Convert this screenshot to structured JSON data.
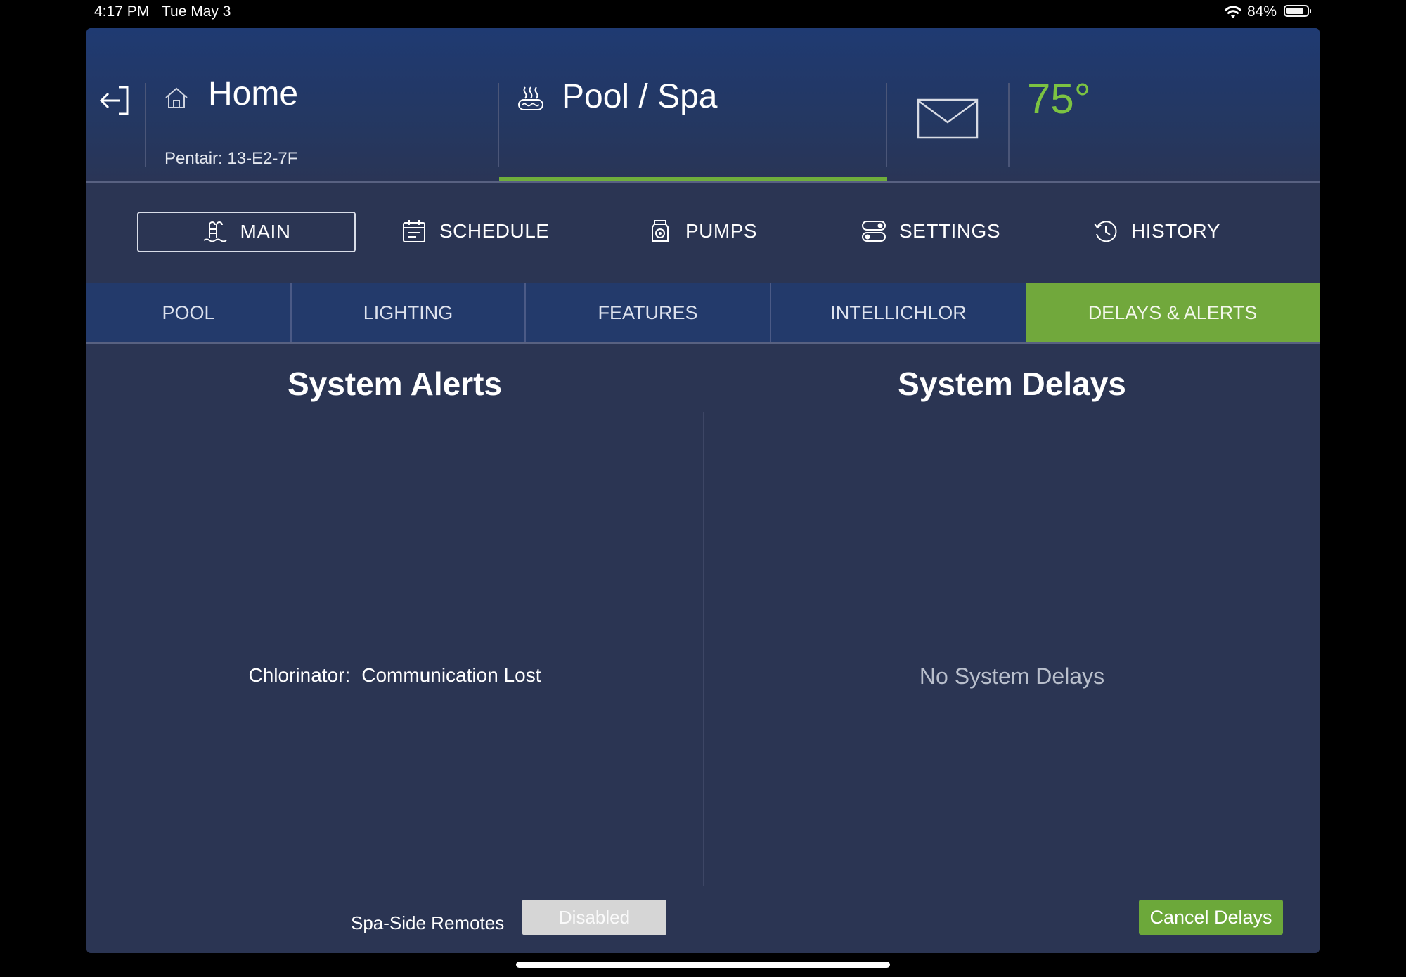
{
  "status_bar": {
    "time": "4:17 PM",
    "date": "Tue May 3",
    "battery_pct": "84%"
  },
  "header": {
    "home_title": "Home",
    "home_subtitle": "Pentair: 13-E2-7F",
    "location_title": "Pool / Spa",
    "temperature": "75°"
  },
  "topnav": {
    "main": "MAIN",
    "schedule": "SCHEDULE",
    "pumps": "PUMPS",
    "settings": "SETTINGS",
    "history": "HISTORY"
  },
  "subtabs": {
    "pool": "POOL",
    "lighting": "LIGHTING",
    "features": "FEATURES",
    "intellichlor": "INTELLICHLOR",
    "delays_alerts": "DELAYS & ALERTS"
  },
  "alerts": {
    "title": "System Alerts",
    "items": [
      {
        "label": "Chlorinator:",
        "message": "Communication Lost"
      }
    ]
  },
  "delays": {
    "title": "System Delays",
    "empty_text": "No System Delays"
  },
  "footer": {
    "spa_remotes_label": "Spa-Side Remotes",
    "spa_remotes_value": "Disabled",
    "cancel_delays": "Cancel Delays"
  },
  "colors": {
    "accent_green": "#6fae3b",
    "temp_green": "#7cc342",
    "background": "#2b3553"
  }
}
